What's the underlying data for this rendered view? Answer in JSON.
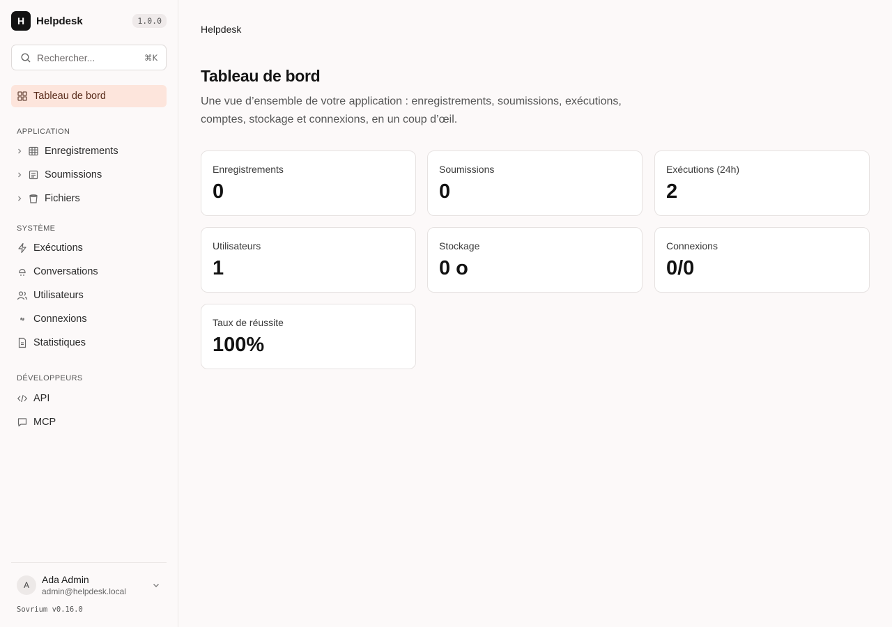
{
  "app": {
    "name": "Helpdesk",
    "logo_letter": "H",
    "version": "1.0.0"
  },
  "search": {
    "placeholder": "Rechercher...",
    "shortcut": "⌘K"
  },
  "nav": {
    "dashboard": {
      "label": "Tableau de bord",
      "icon": "grid-icon"
    },
    "sections": [
      {
        "label": "APPLICATION",
        "items": [
          {
            "label": "Enregistrements",
            "icon": "table-icon",
            "expandable": true
          },
          {
            "label": "Soumissions",
            "icon": "form-icon",
            "expandable": true
          },
          {
            "label": "Fichiers",
            "icon": "bucket-icon",
            "expandable": true
          }
        ]
      },
      {
        "label": "SYSTÈME",
        "items": [
          {
            "label": "Exécutions",
            "icon": "bolt-icon"
          },
          {
            "label": "Conversations",
            "icon": "bot-icon"
          },
          {
            "label": "Utilisateurs",
            "icon": "users-icon"
          },
          {
            "label": "Connexions",
            "icon": "link-icon"
          },
          {
            "label": "Statistiques",
            "icon": "file-chart-icon"
          }
        ]
      },
      {
        "label": "DÉVELOPPEURS",
        "items": [
          {
            "label": "API",
            "icon": "code-icon"
          },
          {
            "label": "MCP",
            "icon": "message-icon"
          }
        ]
      }
    ]
  },
  "user": {
    "initial": "A",
    "name": "Ada Admin",
    "email": "admin@helpdesk.local"
  },
  "footer": {
    "platform_version": "Sovrium v0.16.0"
  },
  "page": {
    "breadcrumb": "Helpdesk",
    "title": "Tableau de bord",
    "description": "Une vue d’ensemble de votre application : enregistrements, soumissions, exécutions, comptes, stockage et connexions, en un coup d’œil."
  },
  "stats": [
    {
      "label": "Enregistrements",
      "value": "0"
    },
    {
      "label": "Soumissions",
      "value": "0"
    },
    {
      "label": "Exécutions (24h)",
      "value": "2"
    },
    {
      "label": "Utilisateurs",
      "value": "1"
    },
    {
      "label": "Stockage",
      "value": "0 o"
    },
    {
      "label": "Connexions",
      "value": "0/0"
    },
    {
      "label": "Taux de réussite",
      "value": "100%"
    }
  ],
  "colors": {
    "active_bg": "#fde5dc",
    "active_text": "#5a2d1c",
    "background": "#fcf9f9",
    "card_border": "#e6e2e1"
  }
}
